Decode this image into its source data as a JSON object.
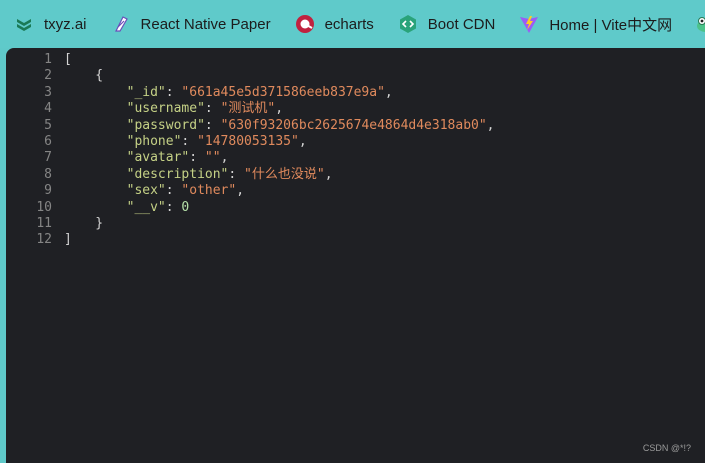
{
  "bookmarks": [
    {
      "label": "txyz.ai",
      "icon": "txyz-logo-icon"
    },
    {
      "label": "React Native Paper",
      "icon": "react-native-paper-logo-icon"
    },
    {
      "label": "echarts",
      "icon": "echarts-logo-icon"
    },
    {
      "label": "Boot CDN",
      "icon": "bootcdn-logo-icon"
    },
    {
      "label": "Home | Vite中文网",
      "icon": "vite-logo-icon"
    },
    {
      "label": "",
      "icon": "frog-logo-icon"
    }
  ],
  "editor": {
    "line_numbers": [
      "1",
      "2",
      "3",
      "4",
      "5",
      "6",
      "7",
      "8",
      "9",
      "10",
      "11",
      "12"
    ],
    "lines": {
      "l1": "[",
      "l2": "    {",
      "l3_key": "\"_id\"",
      "l3_val": "\"661a45e5d371586eeb837e9a\"",
      "l4_key": "\"username\"",
      "l4_val": "\"测试机\"",
      "l5_key": "\"password\"",
      "l5_val": "\"630f93206bc2625674e4864d4e318ab0\"",
      "l6_key": "\"phone\"",
      "l6_val": "\"14780053135\"",
      "l7_key": "\"avatar\"",
      "l7_val": "\"\"",
      "l8_key": "\"description\"",
      "l8_val": "\"什么也没说\"",
      "l9_key": "\"sex\"",
      "l9_val": "\"other\"",
      "l10_key": "\"__v\"",
      "l10_val": "0",
      "l11": "    }",
      "l12": "]"
    }
  },
  "watermark": "CSDN @*!?"
}
